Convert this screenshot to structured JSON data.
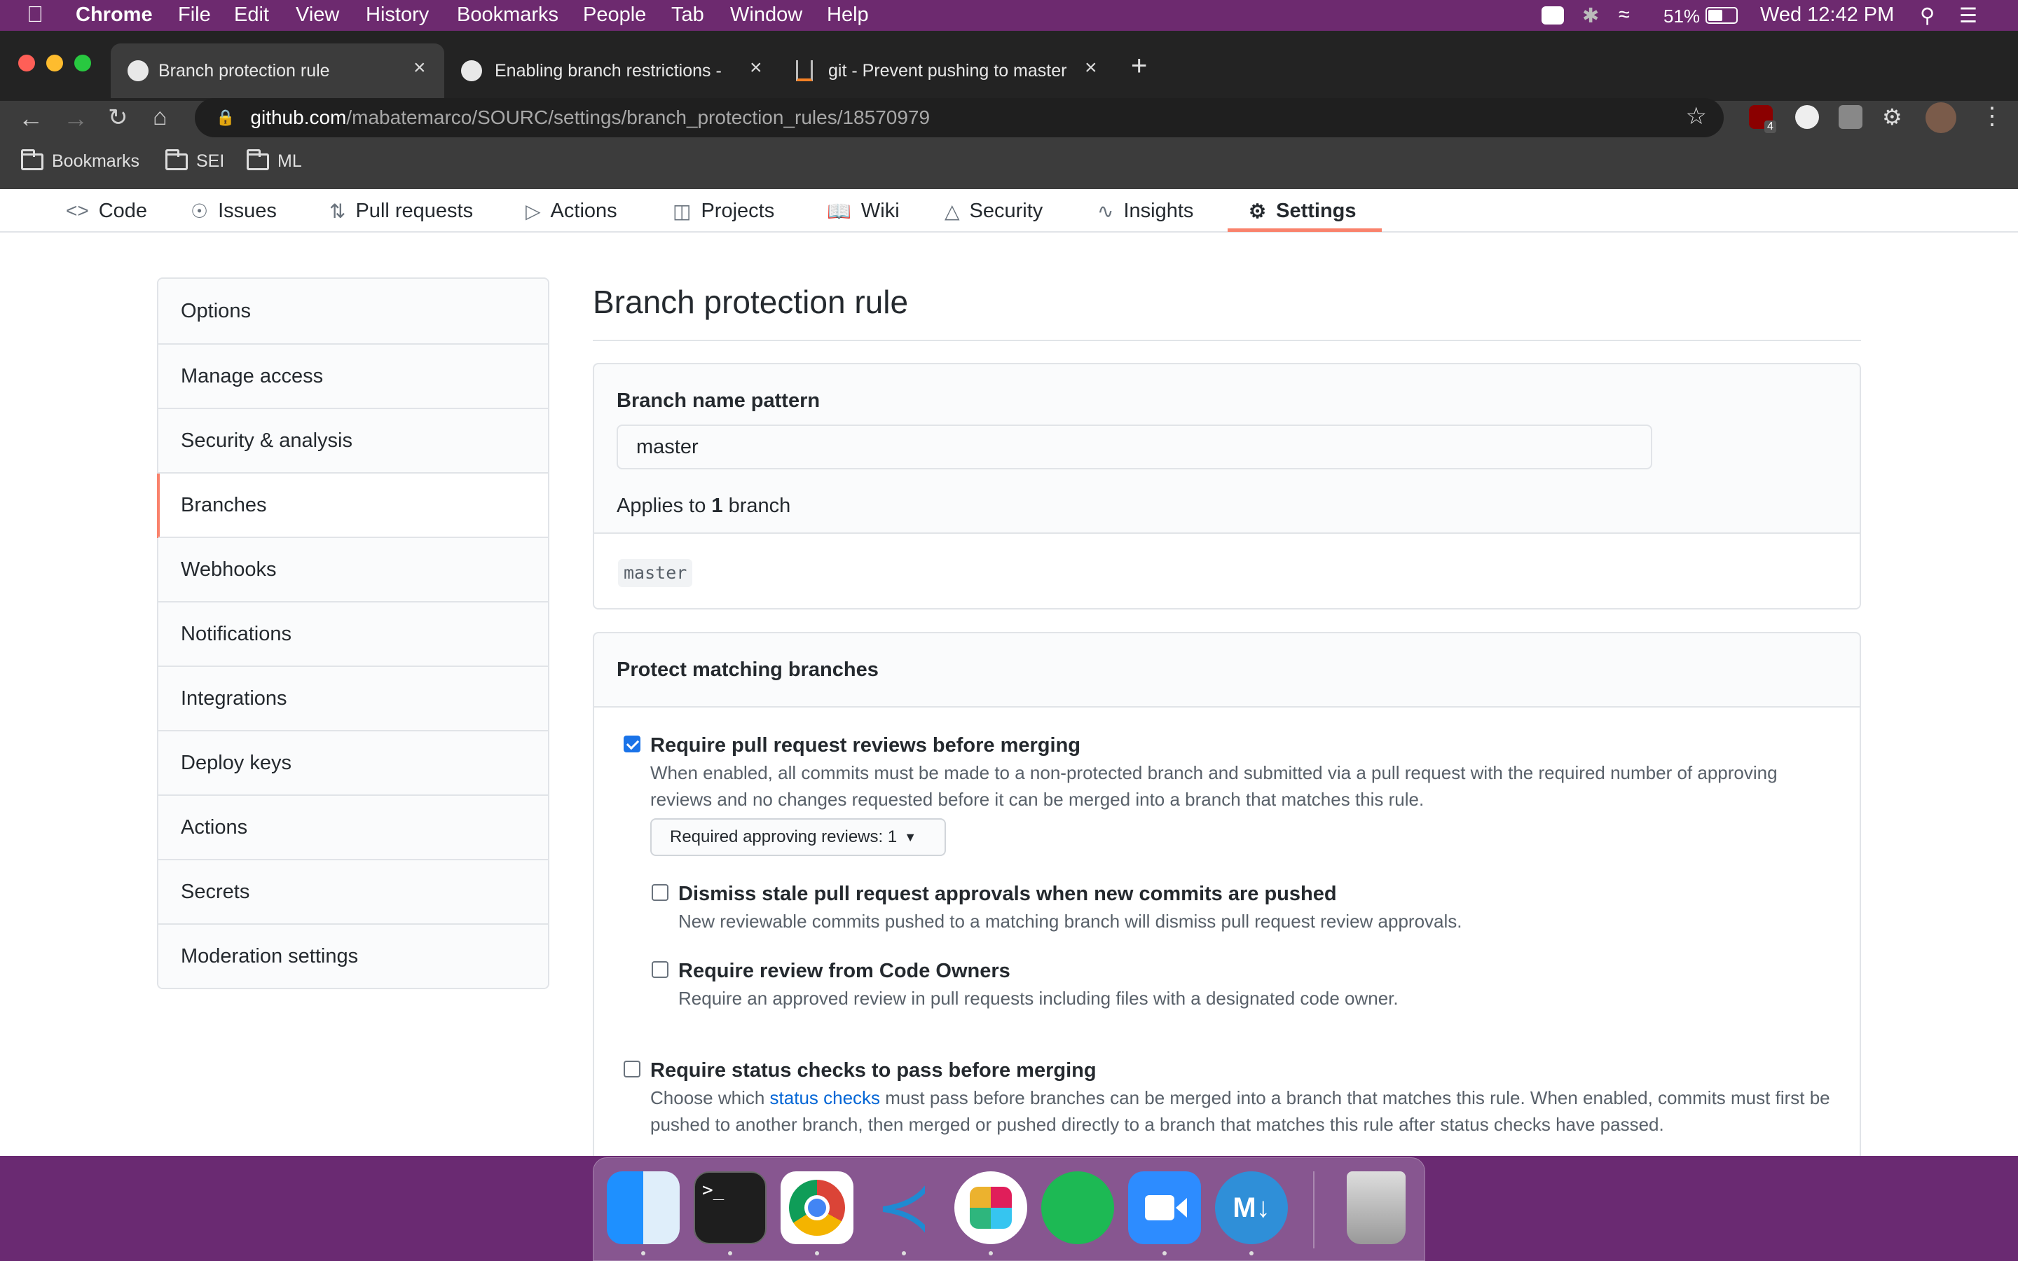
{
  "menubar": {
    "app": "Chrome",
    "items": [
      "File",
      "Edit",
      "View",
      "History",
      "Bookmarks",
      "People",
      "Tab",
      "Window",
      "Help"
    ],
    "battery": "51%",
    "clock": "Wed 12:42 PM"
  },
  "browser": {
    "tabs": [
      {
        "title": "Branch protection rule"
      },
      {
        "title": "Enabling branch restrictions - G"
      },
      {
        "title": "git - Prevent pushing to master"
      }
    ],
    "url_host": "github.com",
    "url_path": "/mabatemarco/SOURC/settings/branch_protection_rules/18570979",
    "extension_badge": "4",
    "bookmarks": [
      "Bookmarks",
      "SEI",
      "ML"
    ]
  },
  "repo_nav": {
    "tabs": [
      {
        "label": "Code",
        "icon": "code-icon"
      },
      {
        "label": "Issues",
        "icon": "issue-icon"
      },
      {
        "label": "Pull requests",
        "icon": "pull-request-icon"
      },
      {
        "label": "Actions",
        "icon": "play-icon"
      },
      {
        "label": "Projects",
        "icon": "project-icon"
      },
      {
        "label": "Wiki",
        "icon": "book-icon"
      },
      {
        "label": "Security",
        "icon": "shield-icon"
      },
      {
        "label": "Insights",
        "icon": "graph-icon"
      },
      {
        "label": "Settings",
        "icon": "gear-icon"
      }
    ],
    "selected": "Settings"
  },
  "sidebar": {
    "items": [
      {
        "label": "Options"
      },
      {
        "label": "Manage access"
      },
      {
        "label": "Security & analysis"
      },
      {
        "label": "Branches"
      },
      {
        "label": "Webhooks"
      },
      {
        "label": "Notifications"
      },
      {
        "label": "Integrations"
      },
      {
        "label": "Deploy keys"
      },
      {
        "label": "Actions"
      },
      {
        "label": "Secrets"
      },
      {
        "label": "Moderation settings"
      }
    ],
    "selected": "Branches"
  },
  "main": {
    "title": "Branch protection rule",
    "branch_name_pattern_label": "Branch name pattern",
    "branch_name_pattern_value": "master",
    "applies_prefix": "Applies to ",
    "applies_count": "1",
    "applies_suffix": " branch",
    "matched_branch": "master",
    "protect_heading": "Protect matching branches",
    "options": {
      "require_pr_reviews": {
        "label": "Require pull request reviews before merging",
        "checked": true,
        "description": "When enabled, all commits must be made to a non-protected branch and submitted via a pull request with the required number of approving reviews and no changes requested before it can be merged into a branch that matches this rule.",
        "reviews_dropdown_label": "Required approving reviews: ",
        "reviews_dropdown_value": "1"
      },
      "dismiss_stale": {
        "label": "Dismiss stale pull request approvals when new commits are pushed",
        "checked": false,
        "description": "New reviewable commits pushed to a matching branch will dismiss pull request review approvals."
      },
      "code_owners": {
        "label": "Require review from Code Owners",
        "checked": false,
        "description": "Require an approved review in pull requests including files with a designated code owner."
      },
      "status_checks": {
        "label": "Require status checks to pass before merging",
        "checked": false,
        "description_before": "Choose which ",
        "description_link": "status checks",
        "description_after": " must pass before branches can be merged into a branch that matches this rule. When enabled, commits must first be pushed to another branch, then merged or pushed directly to a branch that matches this rule after status checks have passed."
      }
    }
  },
  "dock": {
    "apps": [
      "finder-icon",
      "terminal-icon",
      "chrome-icon",
      "vscode-icon",
      "slack-icon",
      "spotify-icon",
      "zoom-icon",
      "markdown-icon",
      "trash-icon"
    ]
  },
  "colors": {
    "menubar_bg": "#6d2a6f",
    "accent_underline": "#f9826c",
    "link": "#0366d6",
    "checkbox_on": "#1a73e8"
  }
}
